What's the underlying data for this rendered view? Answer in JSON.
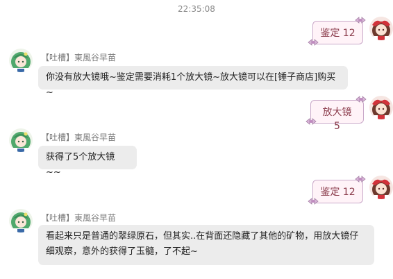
{
  "chat": {
    "timestamp": "22:35:08",
    "sender_name": "【吐槽】東風谷早苗",
    "messages": [
      {
        "direction": "out",
        "text": "鉴定 12"
      },
      {
        "direction": "in",
        "text": "你没有放大镜哦~鉴定需要消耗1个放大镜~放大镜可以在[锤子商店]购买~"
      },
      {
        "direction": "out",
        "text": "放大镜 5"
      },
      {
        "direction": "in",
        "text": "获得了5个放大镜~~"
      },
      {
        "direction": "out",
        "text": "鉴定 12"
      },
      {
        "direction": "in",
        "text": "看起来只是普通的翠绿原石，但其实..在背面还隐藏了其他的矿物，用放大镜仔细观察，意外的获得了玉髓，了不起~"
      }
    ]
  },
  "colors": {
    "incoming_bubble": "#ececec",
    "outgoing_bubble": "#fff3f8",
    "outgoing_border": "#c9a9c9",
    "outgoing_text": "#8a3a4a"
  },
  "icons": {
    "bot_avatar": "green-hair-girl-avatar",
    "user_avatar": "shrine-maiden-avatar",
    "bubble_decoration": "ribbon-icon"
  }
}
